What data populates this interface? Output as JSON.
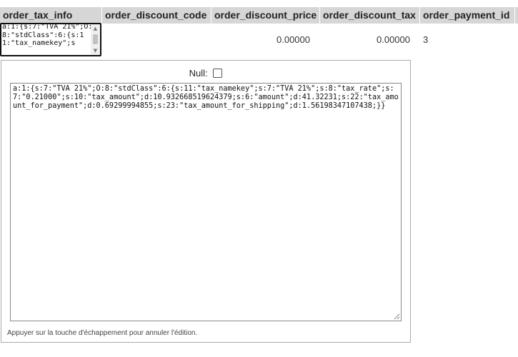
{
  "columns": [
    {
      "name": "order_tax_info"
    },
    {
      "name": "order_discount_code"
    },
    {
      "name": "order_discount_price"
    },
    {
      "name": "order_discount_tax"
    },
    {
      "name": "order_payment_id"
    }
  ],
  "row": {
    "order_tax_info_preview": "a:1:{s:7:\"TVA 21%\";O:8:\"stdClass\":6:{s:11:\"tax_namekey\";s",
    "order_discount_price": "0.00000",
    "order_discount_tax": "0.00000",
    "order_payment_id": "3"
  },
  "editor": {
    "null_label": "Null:",
    "null_checked": false,
    "value": "a:1:{s:7:\"TVA 21%\";O:8:\"stdClass\":6:{s:11:\"tax_namekey\";s:7:\"TVA 21%\";s:8:\"tax_rate\";s:7:\"0.21000\";s:10:\"tax_amount\";d:10.932668519624379;s:6:\"amount\";d:41.32231;s:22:\"tax_amount_for_payment\";d:0.69299994855;s:23:\"tax_amount_for_shipping\";d:1.56198347107438;}}",
    "hint": "Appuyer sur la touche d'échappement pour annuler l'édition."
  }
}
